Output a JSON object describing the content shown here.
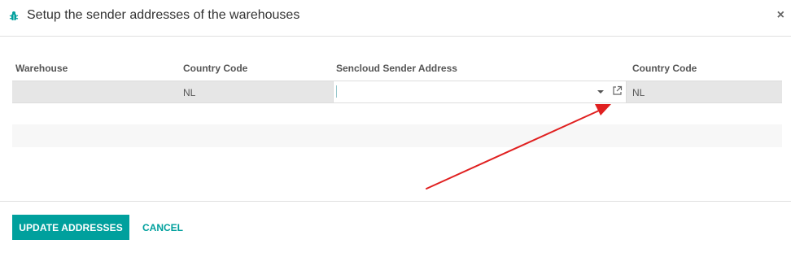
{
  "dialog": {
    "title": "Setup the sender addresses of the warehouses",
    "close_label": "×",
    "header_icon": "bug-icon"
  },
  "table": {
    "columns": [
      "Warehouse",
      "Country Code",
      "Sencloud Sender Address",
      "Country Code"
    ],
    "rows": [
      {
        "warehouse": "",
        "country_code": "NL",
        "sender_address": "",
        "sender_country_code": "NL"
      }
    ]
  },
  "footer": {
    "update_label": "UPDATE ADDRESSES",
    "cancel_label": "CANCEL"
  },
  "colors": {
    "primary": "#00a09d",
    "annotation_arrow": "#e02020"
  }
}
